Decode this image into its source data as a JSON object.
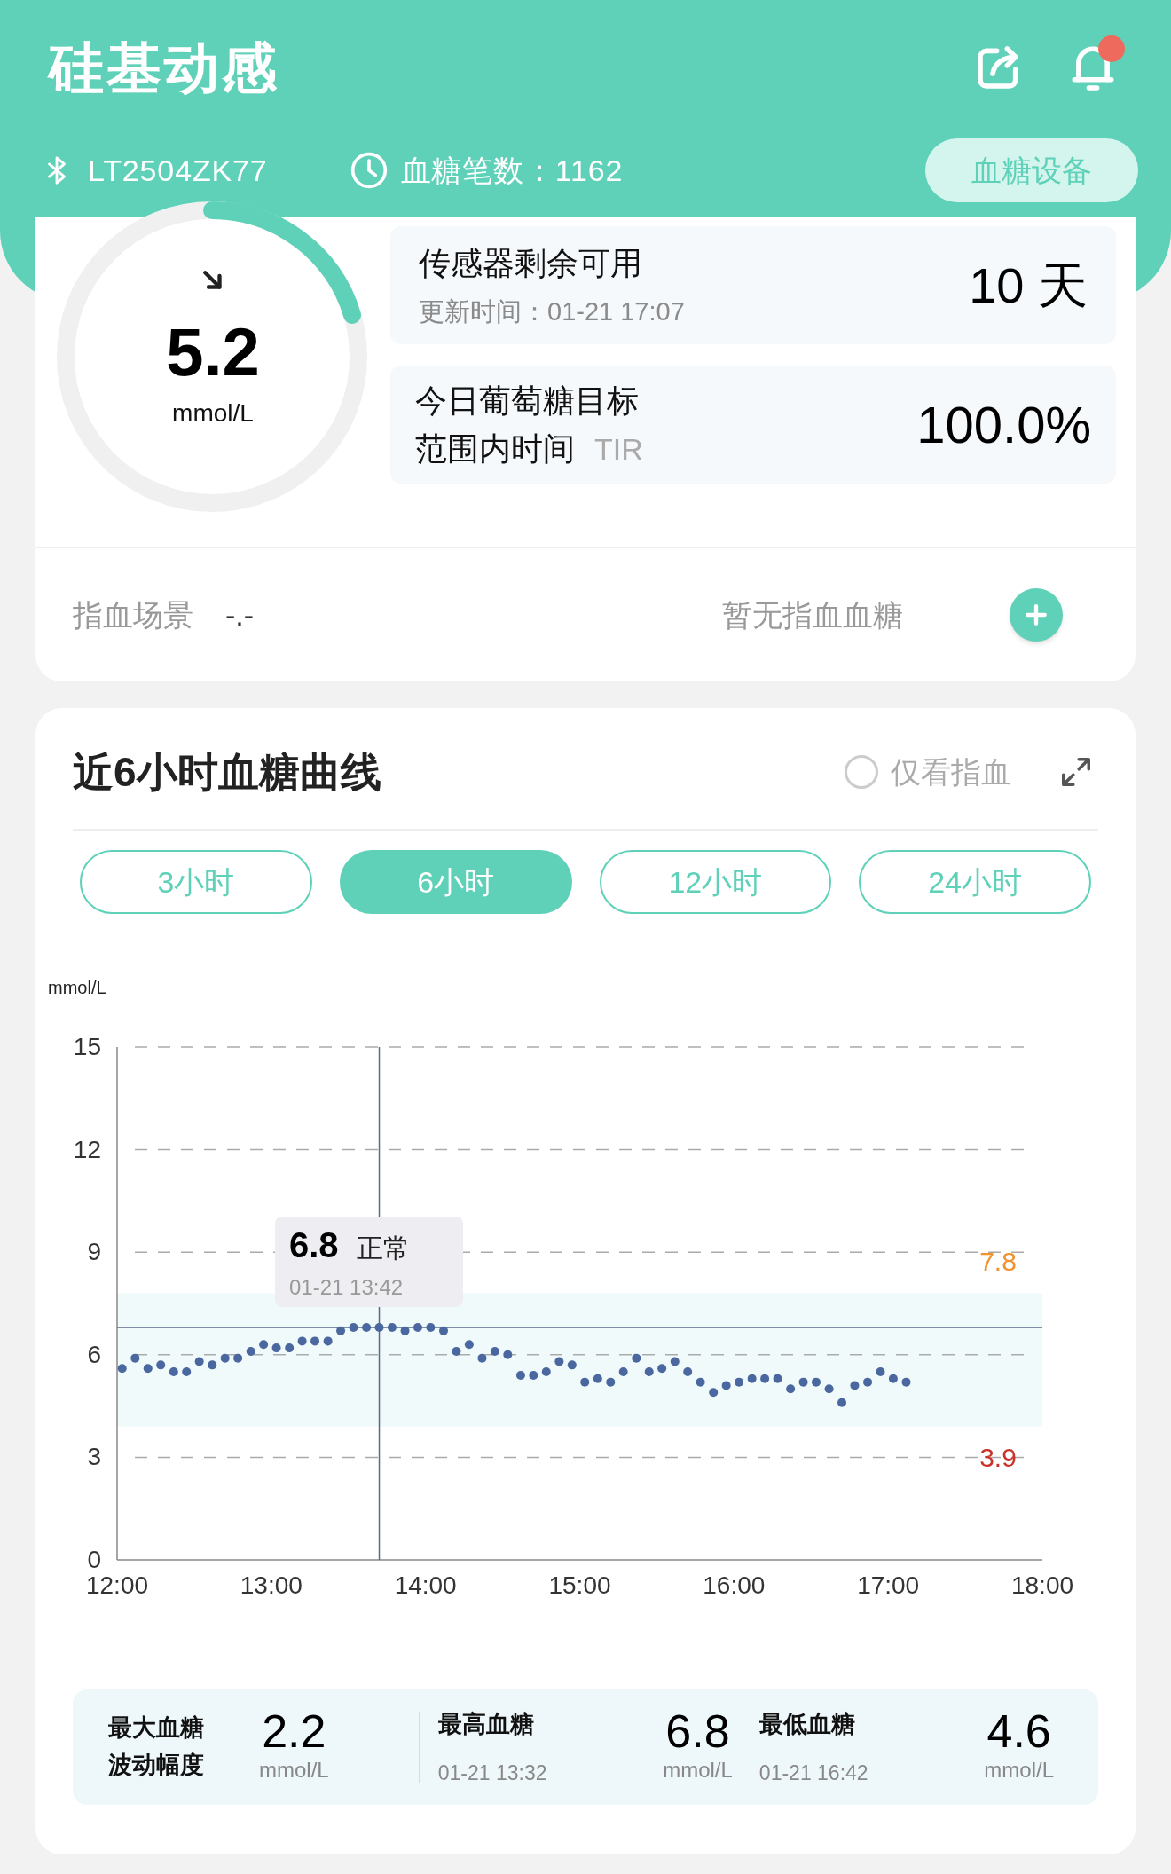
{
  "header": {
    "title": "硅基动感",
    "notification": true,
    "device_id": "LT2504ZK77",
    "reading_count": "血糖笔数：1162",
    "device_button": "血糖设备"
  },
  "current": {
    "value": "5.2",
    "unit": "mmol/L"
  },
  "sensor": {
    "label": "传感器剩余可用",
    "updated": "更新时间：01-21 17:07",
    "remaining": "10 天"
  },
  "tir": {
    "label_lines": [
      "今日葡萄糖目标",
      "范围内时间"
    ],
    "suffix": "TIR",
    "value": "100.0%"
  },
  "fingerstick": {
    "label": "指血场景",
    "value": "-.-",
    "status": "暂无指血血糖"
  },
  "chart_panel": {
    "title": "近6小时血糖曲线",
    "filter": {
      "label": "仅看指血",
      "checked": false
    },
    "ranges": [
      {
        "label": "3小时",
        "selected": false
      },
      {
        "label": "6小时",
        "selected": true
      },
      {
        "label": "12小时",
        "selected": false
      },
      {
        "label": "24小时",
        "selected": false
      }
    ],
    "tooltip": {
      "value": "6.8",
      "status": "正常",
      "time": "01-21 13:42"
    },
    "limits": [
      {
        "label": "7.8",
        "color": "#f0922e"
      },
      {
        "label": "3.9",
        "color": "#c8332b"
      }
    ],
    "chart_data": {
      "type": "scatter",
      "ylabel": "mmol/L",
      "x": [
        12.033,
        12.117,
        12.2,
        12.283,
        12.367,
        12.45,
        12.533,
        12.617,
        12.7,
        12.783,
        12.867,
        12.95,
        13.033,
        13.117,
        13.2,
        13.283,
        13.367,
        13.45,
        13.533,
        13.617,
        13.7,
        13.783,
        13.867,
        13.95,
        14.033,
        14.117,
        14.2,
        14.283,
        14.367,
        14.45,
        14.533,
        14.617,
        14.7,
        14.783,
        14.867,
        14.95,
        15.033,
        15.117,
        15.2,
        15.283,
        15.367,
        15.45,
        15.533,
        15.617,
        15.7,
        15.783,
        15.867,
        15.95,
        16.033,
        16.117,
        16.2,
        16.283,
        16.367,
        16.45,
        16.533,
        16.617,
        16.7,
        16.783,
        16.867,
        16.95,
        17.033,
        17.117
      ],
      "series": [
        {
          "color": "#4a67a0",
          "values": [
            5.6,
            5.9,
            5.6,
            5.7,
            5.5,
            5.5,
            5.8,
            5.7,
            5.9,
            5.9,
            6.1,
            6.3,
            6.2,
            6.2,
            6.4,
            6.4,
            6.4,
            6.7,
            6.8,
            6.8,
            6.8,
            6.8,
            6.7,
            6.8,
            6.8,
            6.7,
            6.1,
            6.3,
            5.9,
            6.1,
            6.0,
            5.4,
            5.4,
            5.5,
            5.8,
            5.7,
            5.2,
            5.3,
            5.2,
            5.5,
            5.9,
            5.5,
            5.6,
            5.8,
            5.5,
            5.2,
            4.9,
            5.1,
            5.2,
            5.3,
            5.3,
            5.3,
            5.0,
            5.2,
            5.2,
            5.0,
            4.6,
            5.1,
            5.2,
            5.5,
            5.3,
            5.2
          ]
        }
      ],
      "xlim": [
        12,
        18
      ],
      "ylim": [
        0,
        15
      ],
      "xticks": [
        {
          "value": 12,
          "label": "12:00"
        },
        {
          "value": 13,
          "label": "13:00"
        },
        {
          "value": 14,
          "label": "14:00"
        },
        {
          "value": 15,
          "label": "15:00"
        },
        {
          "value": 16,
          "label": "16:00"
        },
        {
          "value": 17,
          "label": "17:00"
        },
        {
          "value": 18,
          "label": "18:00"
        }
      ],
      "yticks": [
        0,
        3,
        6,
        9,
        12,
        15
      ],
      "grid": true,
      "bands": [
        {
          "axis": "y",
          "from": 3.9,
          "to": 7.8
        }
      ],
      "ref_lines": [
        {
          "axis": "x",
          "value": 13.7
        },
        {
          "axis": "y",
          "value": 6.8
        }
      ]
    }
  },
  "stats": [
    {
      "kind": "range",
      "label_lines": [
        "最大血糖",
        "波动幅度"
      ],
      "value": "2.2",
      "unit": "mmol/L"
    },
    {
      "kind": "extreme",
      "label": "最高血糖",
      "time": "01-21 13:32",
      "value": "6.8",
      "unit": "mmol/L"
    },
    {
      "kind": "extreme",
      "label": "最低血糖",
      "time": "01-21 16:42",
      "value": "4.6",
      "unit": "mmol/L"
    }
  ]
}
